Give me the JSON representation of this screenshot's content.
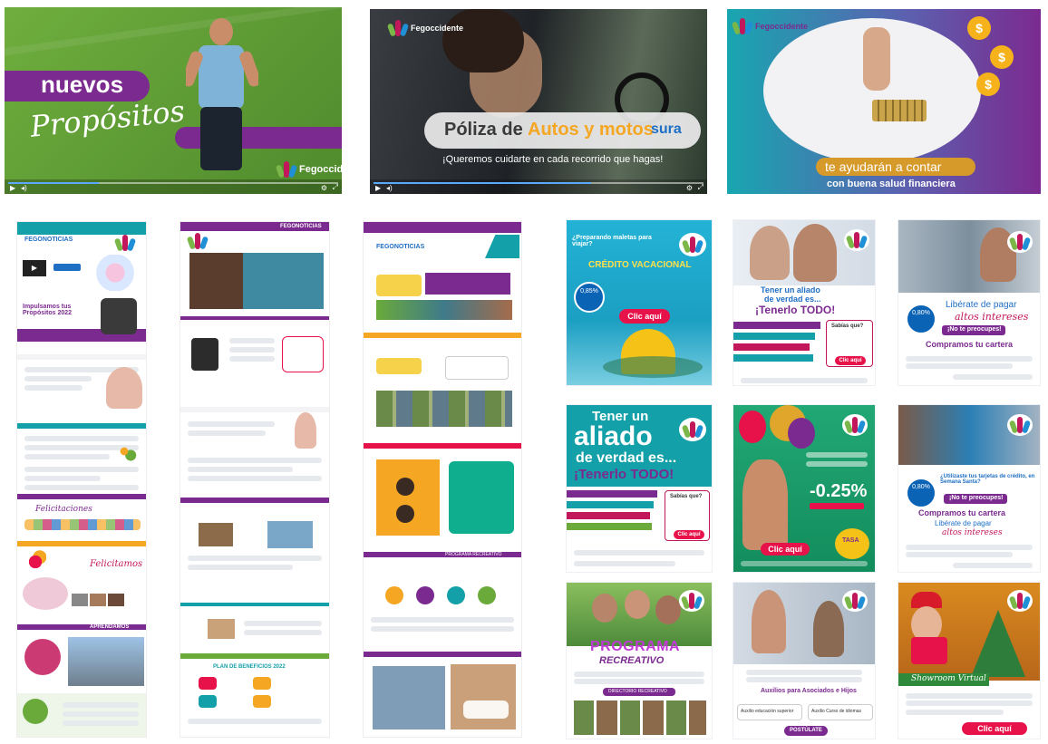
{
  "brand": {
    "name": "Fegoccidente",
    "colors": {
      "purple": "#7b2a8f",
      "green": "#6aaa3a",
      "teal": "#14a0a8",
      "magenta": "#c2185b",
      "blue": "#1f6fc5",
      "orange": "#f5a623"
    }
  },
  "top_banners": {
    "propositos": {
      "word1": "nuevos",
      "word2": "Propósitos"
    },
    "poliza": {
      "title_prefix": "Póliza de",
      "title_highlight": "Autos y motos",
      "title_suffix": "sura",
      "subtitle": "¡Queremos cuidarte en cada recorrido que hagas!"
    },
    "finanzas": {
      "line1": "te ayudarán a contar",
      "line2": "con buena salud financiera"
    }
  },
  "newsletters": {
    "n1": {
      "header": "FEGONOTICIAS",
      "hero": "Impulsamos tus Propósitos 2022",
      "section1": "Felicitaciones",
      "section2": "Felicitamos",
      "section3": "APRENDAMOS"
    },
    "n2": {
      "header": "FEGONOTICIAS",
      "section": "PLAN DE BENEFICIOS 2022"
    },
    "n3": {
      "header": "FEGONOTICIAS",
      "section": "PROGRAMA RECREATIVO"
    }
  },
  "posters": {
    "p1": {
      "title": "¿Preparando maletas para viajar?",
      "highlight": "CRÉDITO VACACIONAL",
      "rate": "0,85%",
      "cta": "Clic aquí"
    },
    "p2": {
      "title_line1": "Tener un aliado",
      "title_line2": "de verdad es...",
      "title_line3": "¡Tenerlo TODO!",
      "side_title": "Sabías que?",
      "cta": "Clic aquí"
    },
    "p3": {
      "title_line1": "Libérate de pagar",
      "title_line2": "altos intereses",
      "tag": "¡No te preocupes!",
      "sub": "Compramos tu cartera",
      "rate": "0,80%"
    },
    "p4": {
      "title_line1": "Tener un",
      "title_line2": "aliado",
      "title_line3": "de verdad es...",
      "title_line4": "¡Tenerlo TODO!",
      "side_title": "Sabías que?",
      "cta": "Clic aquí"
    },
    "p5": {
      "rate": "-0.25%",
      "tasa": "TASA",
      "cta": "Clic aquí"
    },
    "p6": {
      "title": "¿Utilizaste tus tarjetas de crédito, en Semana Santa?",
      "tag": "¡No te preocupes!",
      "sub": "Compramos tu cartera",
      "title_line1": "Libérate de pagar",
      "title_line2": "altos intereses",
      "rate": "0,80%"
    },
    "p7": {
      "title_line1": "PROGRAMA",
      "title_line2": "RECREATIVO",
      "bar": "DIRECTORIO RECREATIVO"
    },
    "p8": {
      "title": "Auxilios para Asociados e Hijos",
      "btn1": "Auxilio educación superior",
      "btn2": "Auxilio Curso de idiomas",
      "cta": "POSTÚLATE"
    },
    "p9": {
      "title": "Showroom Virtual",
      "cta": "Clic aquí"
    }
  },
  "icons": [
    "logo-icon",
    "play-icon",
    "volume-icon",
    "settings-icon",
    "fullscreen-icon",
    "coin-icon"
  ]
}
